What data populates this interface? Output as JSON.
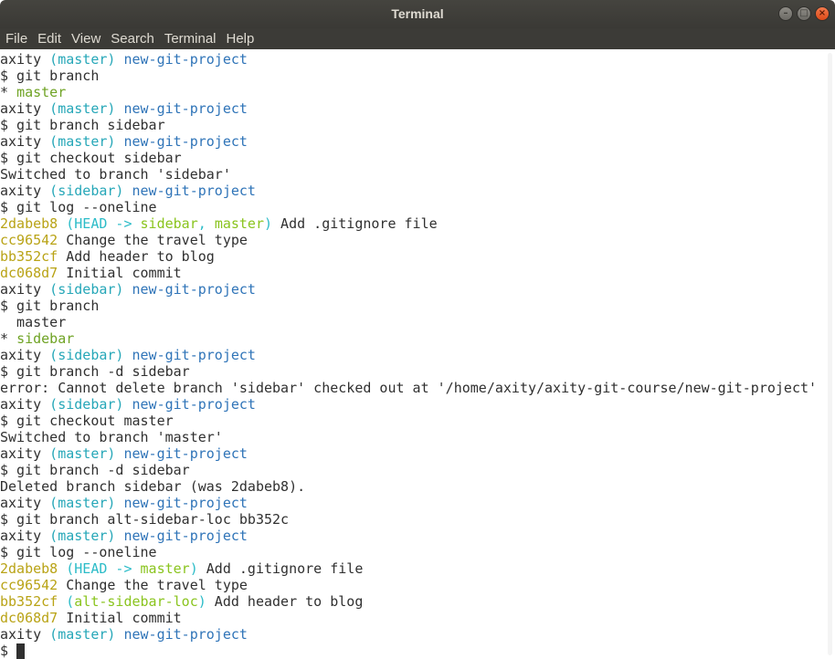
{
  "window": {
    "title": "Terminal",
    "min_glyph": "–",
    "max_glyph": "□",
    "close_glyph": "×"
  },
  "menu": [
    "File",
    "Edit",
    "View",
    "Search",
    "Terminal",
    "Help"
  ],
  "colors": {
    "title_bar": "#3c3b37",
    "branch": "#26a7b8",
    "path": "#2f74b8",
    "current_branch": "#6fa324",
    "hash": "#b9a316",
    "text": "#303030"
  },
  "lines": [
    [
      {
        "t": "axity",
        "c": "user"
      },
      {
        "t": " (master)",
        "c": "branch"
      },
      {
        "t": " new-git-project",
        "c": "path"
      }
    ],
    [
      {
        "t": "$ git branch",
        "c": "text"
      }
    ],
    [
      {
        "t": "* ",
        "c": "text"
      },
      {
        "t": "master",
        "c": "green"
      }
    ],
    [
      {
        "t": "axity",
        "c": "user"
      },
      {
        "t": " (master)",
        "c": "branch"
      },
      {
        "t": " new-git-project",
        "c": "path"
      }
    ],
    [
      {
        "t": "$ git branch sidebar",
        "c": "text"
      }
    ],
    [
      {
        "t": "axity",
        "c": "user"
      },
      {
        "t": " (master)",
        "c": "branch"
      },
      {
        "t": " new-git-project",
        "c": "path"
      }
    ],
    [
      {
        "t": "$ git checkout sidebar",
        "c": "text"
      }
    ],
    [
      {
        "t": "Switched to branch 'sidebar'",
        "c": "text"
      }
    ],
    [
      {
        "t": "axity",
        "c": "user"
      },
      {
        "t": " (sidebar)",
        "c": "branch"
      },
      {
        "t": " new-git-project",
        "c": "path"
      }
    ],
    [
      {
        "t": "$ git log --oneline",
        "c": "text"
      }
    ],
    [
      {
        "t": "2dabeb8",
        "c": "hash"
      },
      {
        "t": " (",
        "c": "ref"
      },
      {
        "t": "HEAD -> ",
        "c": "ref"
      },
      {
        "t": "sidebar",
        "c": "bg"
      },
      {
        "t": ", ",
        "c": "ref"
      },
      {
        "t": "master",
        "c": "bg"
      },
      {
        "t": ")",
        "c": "ref"
      },
      {
        "t": " Add .gitignore file",
        "c": "text"
      }
    ],
    [
      {
        "t": "cc96542",
        "c": "hash"
      },
      {
        "t": " Change the travel type",
        "c": "text"
      }
    ],
    [
      {
        "t": "bb352cf",
        "c": "hash"
      },
      {
        "t": " Add header to blog",
        "c": "text"
      }
    ],
    [
      {
        "t": "dc068d7",
        "c": "hash"
      },
      {
        "t": " Initial commit",
        "c": "text"
      }
    ],
    [
      {
        "t": "axity",
        "c": "user"
      },
      {
        "t": " (sidebar)",
        "c": "branch"
      },
      {
        "t": " new-git-project",
        "c": "path"
      }
    ],
    [
      {
        "t": "$ git branch",
        "c": "text"
      }
    ],
    [
      {
        "t": "  master",
        "c": "text"
      }
    ],
    [
      {
        "t": "* ",
        "c": "text"
      },
      {
        "t": "sidebar",
        "c": "green"
      }
    ],
    [
      {
        "t": "axity",
        "c": "user"
      },
      {
        "t": " (sidebar)",
        "c": "branch"
      },
      {
        "t": " new-git-project",
        "c": "path"
      }
    ],
    [
      {
        "t": "$ git branch -d sidebar",
        "c": "text"
      }
    ],
    [
      {
        "t": "error: Cannot delete branch 'sidebar' checked out at '/home/axity/axity-git-course/new-git-project'",
        "c": "text"
      }
    ],
    [
      {
        "t": "axity",
        "c": "user"
      },
      {
        "t": " (sidebar)",
        "c": "branch"
      },
      {
        "t": " new-git-project",
        "c": "path"
      }
    ],
    [
      {
        "t": "$ git checkout master",
        "c": "text"
      }
    ],
    [
      {
        "t": "Switched to branch 'master'",
        "c": "text"
      }
    ],
    [
      {
        "t": "axity",
        "c": "user"
      },
      {
        "t": " (master)",
        "c": "branch"
      },
      {
        "t": " new-git-project",
        "c": "path"
      }
    ],
    [
      {
        "t": "$ git branch -d sidebar",
        "c": "text"
      }
    ],
    [
      {
        "t": "Deleted branch sidebar (was 2dabeb8).",
        "c": "text"
      }
    ],
    [
      {
        "t": "axity",
        "c": "user"
      },
      {
        "t": " (master)",
        "c": "branch"
      },
      {
        "t": " new-git-project",
        "c": "path"
      }
    ],
    [
      {
        "t": "$ git branch alt-sidebar-loc bb352c",
        "c": "text"
      }
    ],
    [
      {
        "t": "axity",
        "c": "user"
      },
      {
        "t": " (master)",
        "c": "branch"
      },
      {
        "t": " new-git-project",
        "c": "path"
      }
    ],
    [
      {
        "t": "$ git log --oneline",
        "c": "text"
      }
    ],
    [
      {
        "t": "2dabeb8",
        "c": "hash"
      },
      {
        "t": " (",
        "c": "ref"
      },
      {
        "t": "HEAD -> ",
        "c": "ref"
      },
      {
        "t": "master",
        "c": "bg"
      },
      {
        "t": ")",
        "c": "ref"
      },
      {
        "t": " Add .gitignore file",
        "c": "text"
      }
    ],
    [
      {
        "t": "cc96542",
        "c": "hash"
      },
      {
        "t": " Change the travel type",
        "c": "text"
      }
    ],
    [
      {
        "t": "bb352cf",
        "c": "hash"
      },
      {
        "t": " (",
        "c": "ref"
      },
      {
        "t": "alt-sidebar-loc",
        "c": "bg"
      },
      {
        "t": ")",
        "c": "ref"
      },
      {
        "t": " Add header to blog",
        "c": "text"
      }
    ],
    [
      {
        "t": "dc068d7",
        "c": "hash"
      },
      {
        "t": " Initial commit",
        "c": "text"
      }
    ],
    [
      {
        "t": "axity",
        "c": "user"
      },
      {
        "t": " (master)",
        "c": "branch"
      },
      {
        "t": " new-git-project",
        "c": "path"
      }
    ],
    [
      {
        "t": "$ ",
        "c": "text"
      },
      {
        "t": "",
        "c": "cursor"
      }
    ]
  ]
}
